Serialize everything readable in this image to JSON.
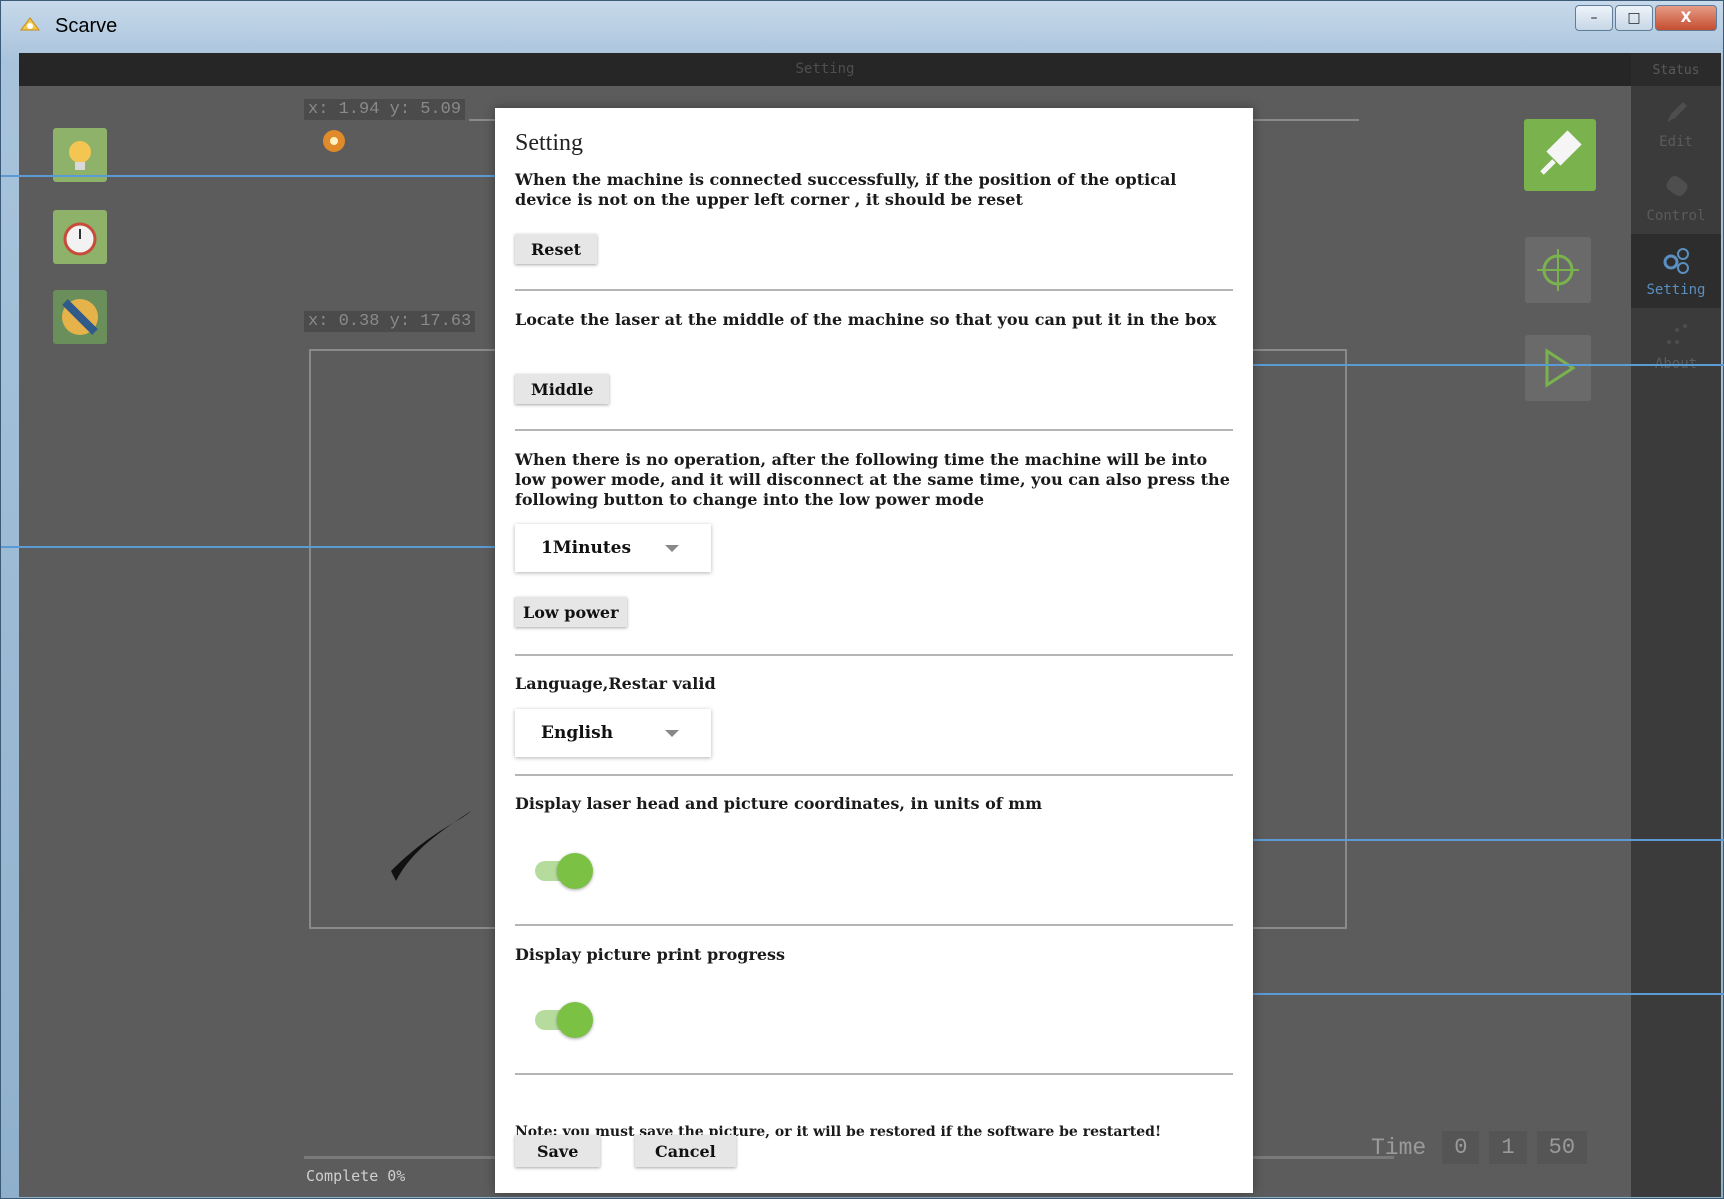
{
  "window": {
    "title": "Scarve",
    "minimize_glyph": "–",
    "maximize_glyph": "□",
    "close_glyph": "X"
  },
  "topbar": {
    "title": "Setting"
  },
  "status_sidebar": {
    "header": "Status",
    "items": [
      {
        "label": "Edit",
        "icon": "pen-icon"
      },
      {
        "label": "Control",
        "icon": "gamepad-icon"
      },
      {
        "label": "Setting",
        "icon": "gears-icon",
        "active": true
      },
      {
        "label": "About",
        "icon": "dots-icon"
      }
    ]
  },
  "readouts": {
    "laser": "x: 1.94 y: 5.09",
    "picture": "x: 0.38 y: 17.63"
  },
  "canvas": {
    "complete": "Complete 0%"
  },
  "time": {
    "label": "Time",
    "hours": "0",
    "minutes": "1",
    "seconds": "50"
  },
  "dialog": {
    "title": "Setting",
    "reset": {
      "text": "When the machine is connected successfully, if the position of the optical device is not on the upper left corner , it should be reset",
      "button": "Reset"
    },
    "middle": {
      "text": "Locate the laser at the middle of the machine so that you can put it in the box",
      "button": "Middle"
    },
    "low_power": {
      "text": "When there is no operation, after the following time the machine will be into low power mode, and it will disconnect at the same time, you can also press the following button to change into the low power mode",
      "select_value": "1Minutes",
      "button": "Low power"
    },
    "language": {
      "text": "Language,Restar valid",
      "select_value": "English"
    },
    "coords_toggle": {
      "text": "Display laser head and picture coordinates, in units of mm",
      "on": true
    },
    "progress_toggle": {
      "text": "Display picture print progress",
      "on": true
    },
    "note": "Note: you must save the picture, or it will be restored if the software be restarted!",
    "save": "Save",
    "cancel": "Cancel"
  },
  "colors": {
    "accent_green": "#7ac144",
    "callout_blue": "#5b9bd5",
    "active_nav": "#5a8fbf"
  }
}
